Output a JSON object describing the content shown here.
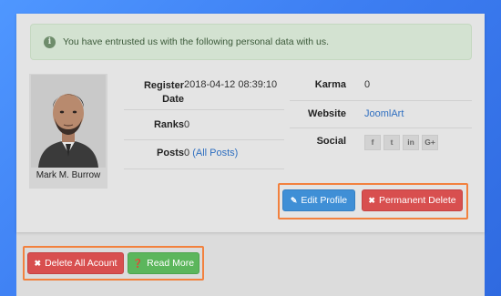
{
  "alert": {
    "message": "You have entrusted us with the following personal data with us."
  },
  "profile": {
    "name": "Mark M. Burrow",
    "register_date_label_1": "Register",
    "register_date_label_2": "Date",
    "register_date_value": "2018-04-12 08:39:10",
    "ranks_label": "Ranks",
    "ranks_value": "0",
    "posts_label": "Posts",
    "posts_value": "0",
    "posts_link": "(All Posts)",
    "karma_label": "Karma",
    "karma_value": "0",
    "website_label": "Website",
    "website_value": "JoomlArt",
    "social_label": "Social"
  },
  "social_icons": [
    "facebook-icon",
    "twitter-icon",
    "linkedin-icon",
    "google-plus-icon"
  ],
  "social_glyphs": {
    "facebook": "f",
    "twitter": "t",
    "linkedin": "in",
    "googleplus": "G+"
  },
  "actions": {
    "edit_profile": "Edit Profile",
    "permanent_delete": "Permanent Delete",
    "delete_all_account": "Delete All Acount",
    "read_more": "Read More"
  },
  "colors": {
    "highlight": "#f2813e",
    "primary": "#3f8fd6",
    "danger": "#d84f4f",
    "success": "#5cb65c",
    "background": "#3d7ef2"
  }
}
